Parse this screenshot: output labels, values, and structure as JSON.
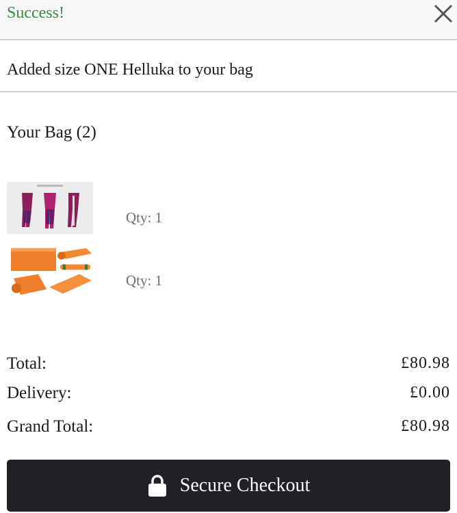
{
  "header": {
    "title": "Success!",
    "close_icon": "close-icon"
  },
  "message": "Added size ONE Helluka to your bag",
  "bag": {
    "heading": "Your Bag (2)",
    "items": [
      {
        "image": "leggings-product-image",
        "qty_label": "Qty: 1"
      },
      {
        "image": "yoga-mat-product-image",
        "qty_label": "Qty: 1"
      }
    ]
  },
  "totals": {
    "total_label": "Total:",
    "total_value": "£80.98",
    "delivery_label": "Delivery:",
    "delivery_value": "£0.00",
    "grand_label": "Grand Total:",
    "grand_value": "£80.98"
  },
  "checkout": {
    "label": "Secure Checkout",
    "icon": "lock-icon"
  },
  "colors": {
    "success_green": "#3b8a3e",
    "checkout_bg": "#1f2127",
    "qty_gray": "#6d6d6d"
  }
}
